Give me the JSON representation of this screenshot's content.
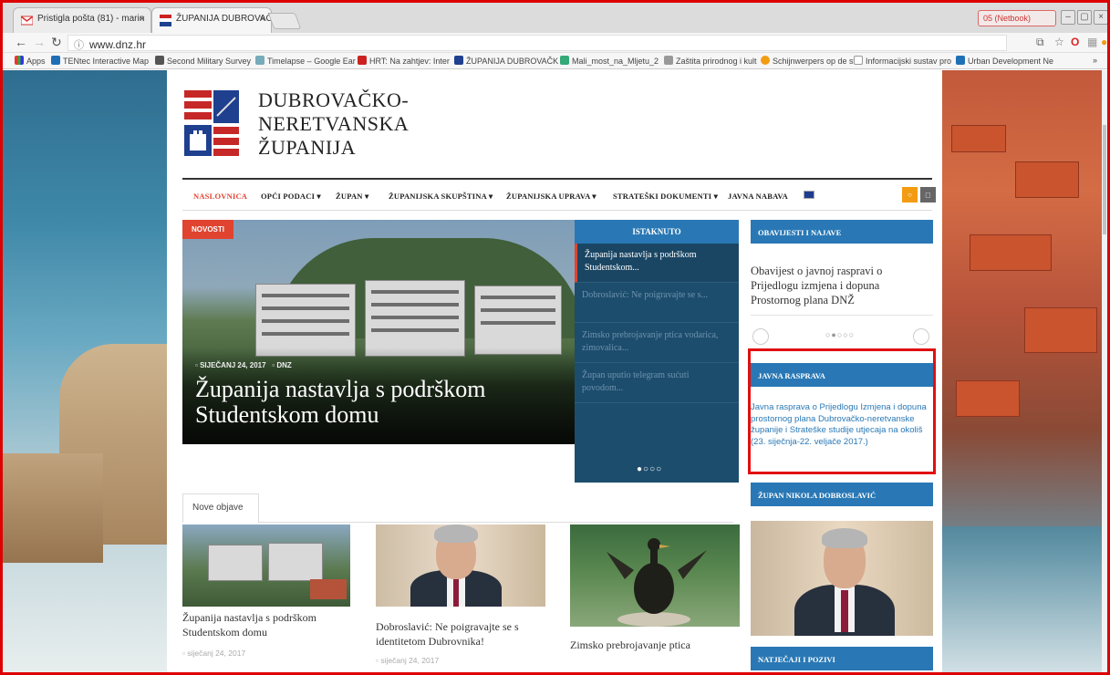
{
  "browser": {
    "tabs": [
      {
        "label": "Pristigla pošta (81) - marin",
        "active": false
      },
      {
        "label": "ŽUPANIJA DUBROVAČKO N",
        "active": true
      }
    ],
    "profile_label": "05 (Netbook)",
    "url": "www.dnz.hr",
    "bookmarks": [
      "Apps",
      "TENtec Interactive Map",
      "Second Military Survey",
      "Timelapse – Google Ear",
      "HRT: Na zahtjev: Inter",
      "ŽUPANIJA DUBROVAČK",
      "Mali_most_na_Mljetu_2",
      "Zaštita prirodnog i kult",
      "Schijnwerpers op de sta",
      "Informacijski sustav pro",
      "Urban Development Ne"
    ],
    "bookmarks_overflow": "»"
  },
  "site": {
    "title_lines": [
      "DUBROVAČKO-",
      "NERETVANSKA",
      "ŽUPANIJA"
    ],
    "nav": [
      {
        "label": "NASLOVNICA",
        "active": true
      },
      {
        "label": "OPĆI PODACI ▾"
      },
      {
        "label": "ŽUPAN ▾"
      },
      {
        "label": "ŽUPANIJSKA SKUPŠTINA ▾"
      },
      {
        "label": "ŽUPANIJSKA UPRAVA ▾"
      },
      {
        "label": "STRATEŠKI DOKUMENTI ▾"
      },
      {
        "label": "JAVNA NABAVA"
      }
    ]
  },
  "hero": {
    "badge": "NOVOSTI",
    "date": "SIJEČANJ 24, 2017",
    "author": "DNZ",
    "title": "Županija nastavlja s podrškom Studentskom domu"
  },
  "istaknuto": {
    "heading": "ISTAKNUTO",
    "items": [
      "Županija nastavlja s podrškom Studentskom...",
      "Dobroslavić: Ne poigravajte se s...",
      "Zimsko prebrojavanje ptica vodarica, zimovalica...",
      "Župan uputio telegram sućuti povodom..."
    ],
    "dots": "●○○○"
  },
  "sidebar": {
    "obavijesti_heading": "OBAVIJESTI I NAJAVE",
    "obavijesti_text": "Obavijest o javnoj raspravi o Prijedlogu izmjena i dopuna Prostornog plana DNŽ",
    "obavijesti_dots": "○●○○○",
    "javna_heading": "JAVNA RASPRAVA",
    "javna_text": "Javna rasprava o Prijedlogu Izmjena i dopuna prostornog plana Dubrovačko-neretvanske županije i Strateške studije utjecaja na okoliš (23. siječnja-22. veljače 2017.)",
    "zupan_heading": "ŽUPAN NIKOLA DOBROSLAVIĆ",
    "natjecaji_heading": "NATJEČAJI I POZIVI"
  },
  "nove_objave": {
    "tab_label": "Nove objave",
    "cards": [
      {
        "title": "Županija nastavlja s podrškom Studentskom domu",
        "date": "siječanj 24, 2017"
      },
      {
        "title": "Dobroslavić: Ne poigravajte se s identitetom Dubrovnika!",
        "date": "siječanj 24, 2017"
      },
      {
        "title": "Zimsko prebrojavanje ptica",
        "date": ""
      }
    ]
  },
  "colors": {
    "accent_red": "#e0432f",
    "brand_blue": "#2978b5",
    "panel_dark_blue": "#1d4d6d",
    "highlight_box": "#e01010"
  }
}
